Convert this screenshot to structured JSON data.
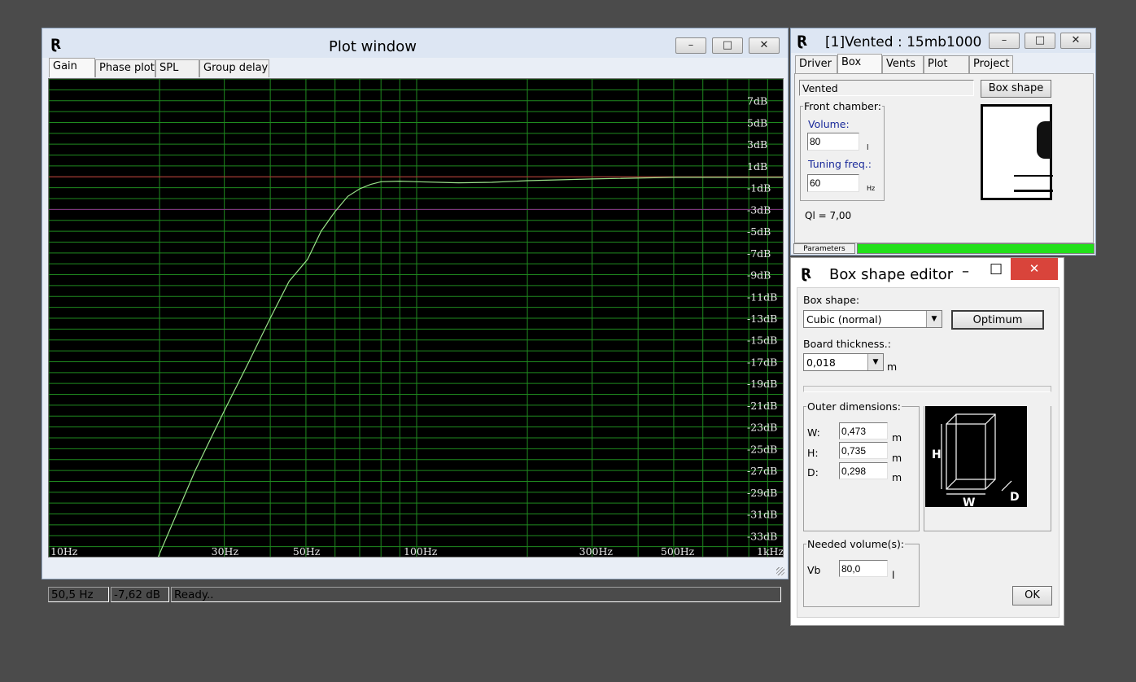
{
  "plot_window": {
    "title": "Plot window",
    "tabs": [
      "Gain",
      "Phase plot",
      "SPL",
      "Group delay"
    ],
    "active_tab": "Gain",
    "status": {
      "freq": "50,5 Hz",
      "gain": "-7,62 dB",
      "message": "Ready.."
    }
  },
  "chart_data": {
    "type": "line",
    "x_scale": "log",
    "xlim": [
      10,
      1000
    ],
    "ylim": [
      -35,
      9
    ],
    "x_tick_labels": [
      {
        "x": 10,
        "label": "10Hz"
      },
      {
        "x": 30,
        "label": "30Hz"
      },
      {
        "x": 50,
        "label": "50Hz"
      },
      {
        "x": 100,
        "label": "100Hz"
      },
      {
        "x": 300,
        "label": "300Hz"
      },
      {
        "x": 500,
        "label": "500Hz"
      },
      {
        "x": 1000,
        "label": "1kHz"
      }
    ],
    "y_tick_labels": [
      "7dB",
      "5dB",
      "3dB",
      "1dB",
      "-1dB",
      "-3dB",
      "-5dB",
      "-7dB",
      "-9dB",
      "-11dB",
      "-13dB",
      "-15dB",
      "-17dB",
      "-19dB",
      "-21dB",
      "-23dB",
      "-25dB",
      "-27dB",
      "-29dB",
      "-31dB",
      "-33dB"
    ],
    "y_tick_values": [
      7,
      5,
      3,
      1,
      -1,
      -3,
      -5,
      -7,
      -9,
      -11,
      -13,
      -15,
      -17,
      -19,
      -21,
      -23,
      -25,
      -27,
      -29,
      -31,
      -33
    ],
    "reference_lines": [
      {
        "y": 0,
        "color": "#c8283c"
      },
      {
        "y": -3,
        "color": "#8a2c8a"
      }
    ],
    "series": [
      {
        "color": "#9ae28a",
        "points": [
          [
            19.8,
            -35
          ],
          [
            25,
            -27
          ],
          [
            30,
            -21.5
          ],
          [
            35,
            -17
          ],
          [
            40,
            -13
          ],
          [
            45,
            -9.6
          ],
          [
            50.5,
            -7.6
          ],
          [
            55,
            -5
          ],
          [
            60,
            -3.2
          ],
          [
            65,
            -1.8
          ],
          [
            70,
            -1.1
          ],
          [
            75,
            -0.7
          ],
          [
            80,
            -0.45
          ],
          [
            90,
            -0.4
          ],
          [
            100,
            -0.45
          ],
          [
            130,
            -0.55
          ],
          [
            160,
            -0.5
          ],
          [
            200,
            -0.35
          ],
          [
            300,
            -0.2
          ],
          [
            500,
            -0.05
          ],
          [
            1000,
            -0.05
          ]
        ]
      }
    ],
    "grid": true,
    "background": "#000000",
    "grid_color": "#1f8a1f"
  },
  "project_window": {
    "title": "[1]Vented : 15mb1000",
    "tabs": [
      "Driver",
      "Box",
      "Vents",
      "Plot",
      "Project"
    ],
    "active_tab": "Box",
    "box_type": "Vented",
    "box_shape_button": "Box shape",
    "front_chamber_label": "Front chamber:",
    "volume_label": "Volume:",
    "volume_value": "80",
    "volume_unit": "l",
    "tuning_label": "Tuning freq.:",
    "tuning_value": "60",
    "tuning_unit": "Hz",
    "ql_text": "Ql = 7,00",
    "status_tab": "Parameters",
    "progress": 1.0
  },
  "box_shape_editor": {
    "title": "Box shape editor",
    "box_shape_label": "Box shape:",
    "box_shape_value": "Cubic (normal)",
    "optimum_button": "Optimum",
    "board_thickness_label": "Board thickness.:",
    "board_thickness_value": "0,018",
    "board_thickness_unit": "m",
    "outer_dimensions_label": "Outer dimensions:",
    "w_label": "W:",
    "w_value": "0,473",
    "h_label": "H:",
    "h_value": "0,735",
    "d_label": "D:",
    "d_value": "0,298",
    "dim_unit": "m",
    "diagram": {
      "h": "H",
      "w": "W",
      "d": "D"
    },
    "needed_volume_label": "Needed volume(s):",
    "vb_label": "Vb",
    "vb_value": "80,0",
    "vb_unit": "l",
    "ok_button": "OK"
  }
}
